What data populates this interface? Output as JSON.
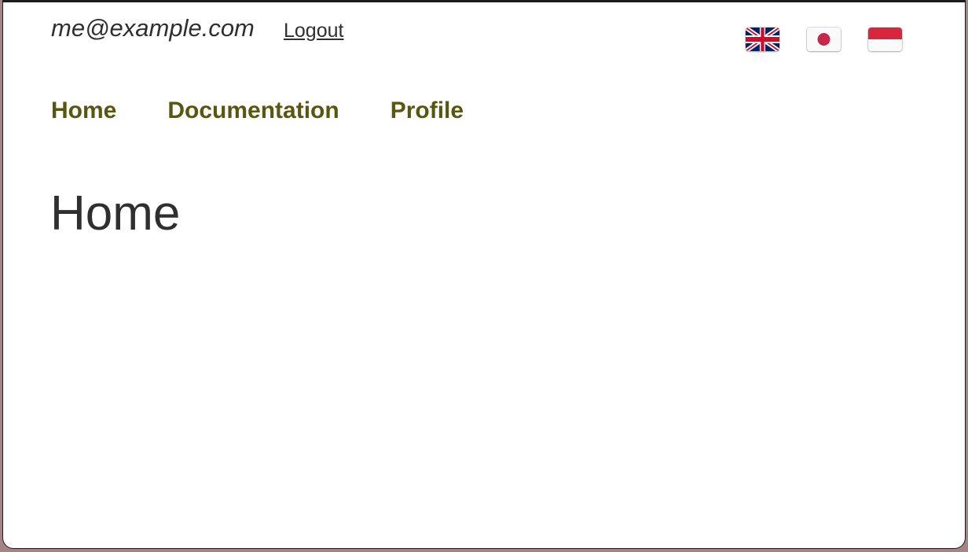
{
  "header": {
    "user_email": "me@example.com",
    "logout_label": "Logout",
    "languages": [
      {
        "icon": "uk-flag-icon"
      },
      {
        "icon": "japan-flag-icon"
      },
      {
        "icon": "indonesia-flag-icon"
      }
    ]
  },
  "nav": {
    "items": [
      {
        "label": "Home"
      },
      {
        "label": "Documentation"
      },
      {
        "label": "Profile"
      }
    ]
  },
  "main": {
    "title": "Home"
  },
  "colors": {
    "nav_link": "#58560f",
    "text": "#2f2f2f",
    "background": "#ffffff",
    "outer_background": "#a48484"
  }
}
